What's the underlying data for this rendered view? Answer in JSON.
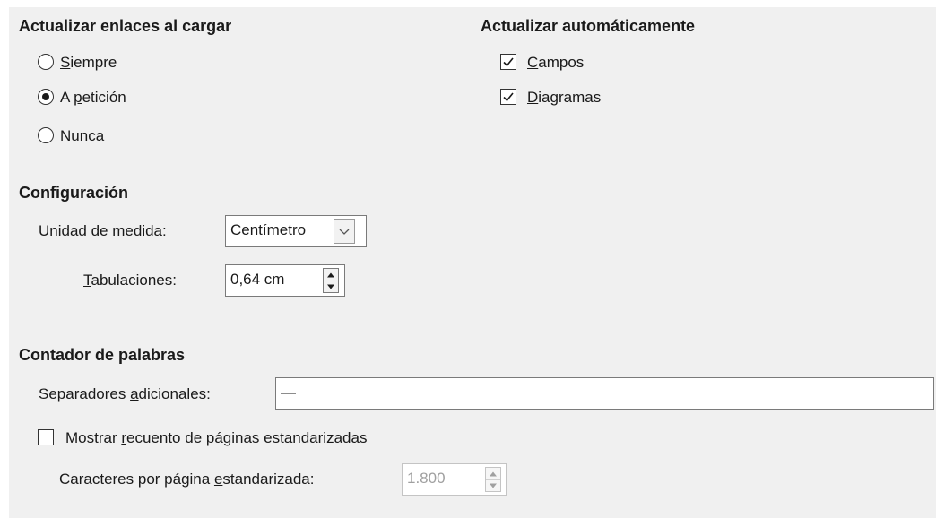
{
  "update_links": {
    "title": "Actualizar enlaces al cargar",
    "options": [
      {
        "prefix": "",
        "mnemonic": "S",
        "rest": "iempre",
        "selected": false
      },
      {
        "prefix": "A ",
        "mnemonic": "p",
        "rest": "etición",
        "selected": true
      },
      {
        "prefix": "",
        "mnemonic": "N",
        "rest": "unca",
        "selected": false
      }
    ]
  },
  "auto_update": {
    "title": "Actualizar automáticamente",
    "fields": {
      "mnemonic": "C",
      "rest": "ampos",
      "checked": true
    },
    "charts": {
      "mnemonic": "D",
      "rest": "iagramas",
      "checked": true
    }
  },
  "settings": {
    "title": "Configuración",
    "unit": {
      "label_pre": "Unidad de ",
      "label_mnemonic": "m",
      "label_post": "edida:",
      "value": "Centímetro"
    },
    "tabs": {
      "label_mnemonic": "T",
      "label_post": "abulaciones:",
      "value": "0,64 cm"
    }
  },
  "word_count": {
    "title": "Contador de palabras",
    "separators": {
      "label_pre": "Separadores ",
      "label_mnemonic": "a",
      "label_post": "dicionales:",
      "value": "—"
    },
    "show_std_pages": {
      "label_pre": "Mostrar ",
      "label_mnemonic": "r",
      "label_post": "ecuento de páginas estandarizadas",
      "checked": false
    },
    "chars_per_page": {
      "label_pre": "Caracteres por página ",
      "label_mnemonic": "e",
      "label_post": "standarizada:",
      "value": "1.800"
    }
  },
  "icons": {
    "combo_arrow": "chevron-down-icon",
    "spin_up": "spin-up-icon",
    "spin_down": "spin-down-icon",
    "check": "checkmark-icon"
  }
}
